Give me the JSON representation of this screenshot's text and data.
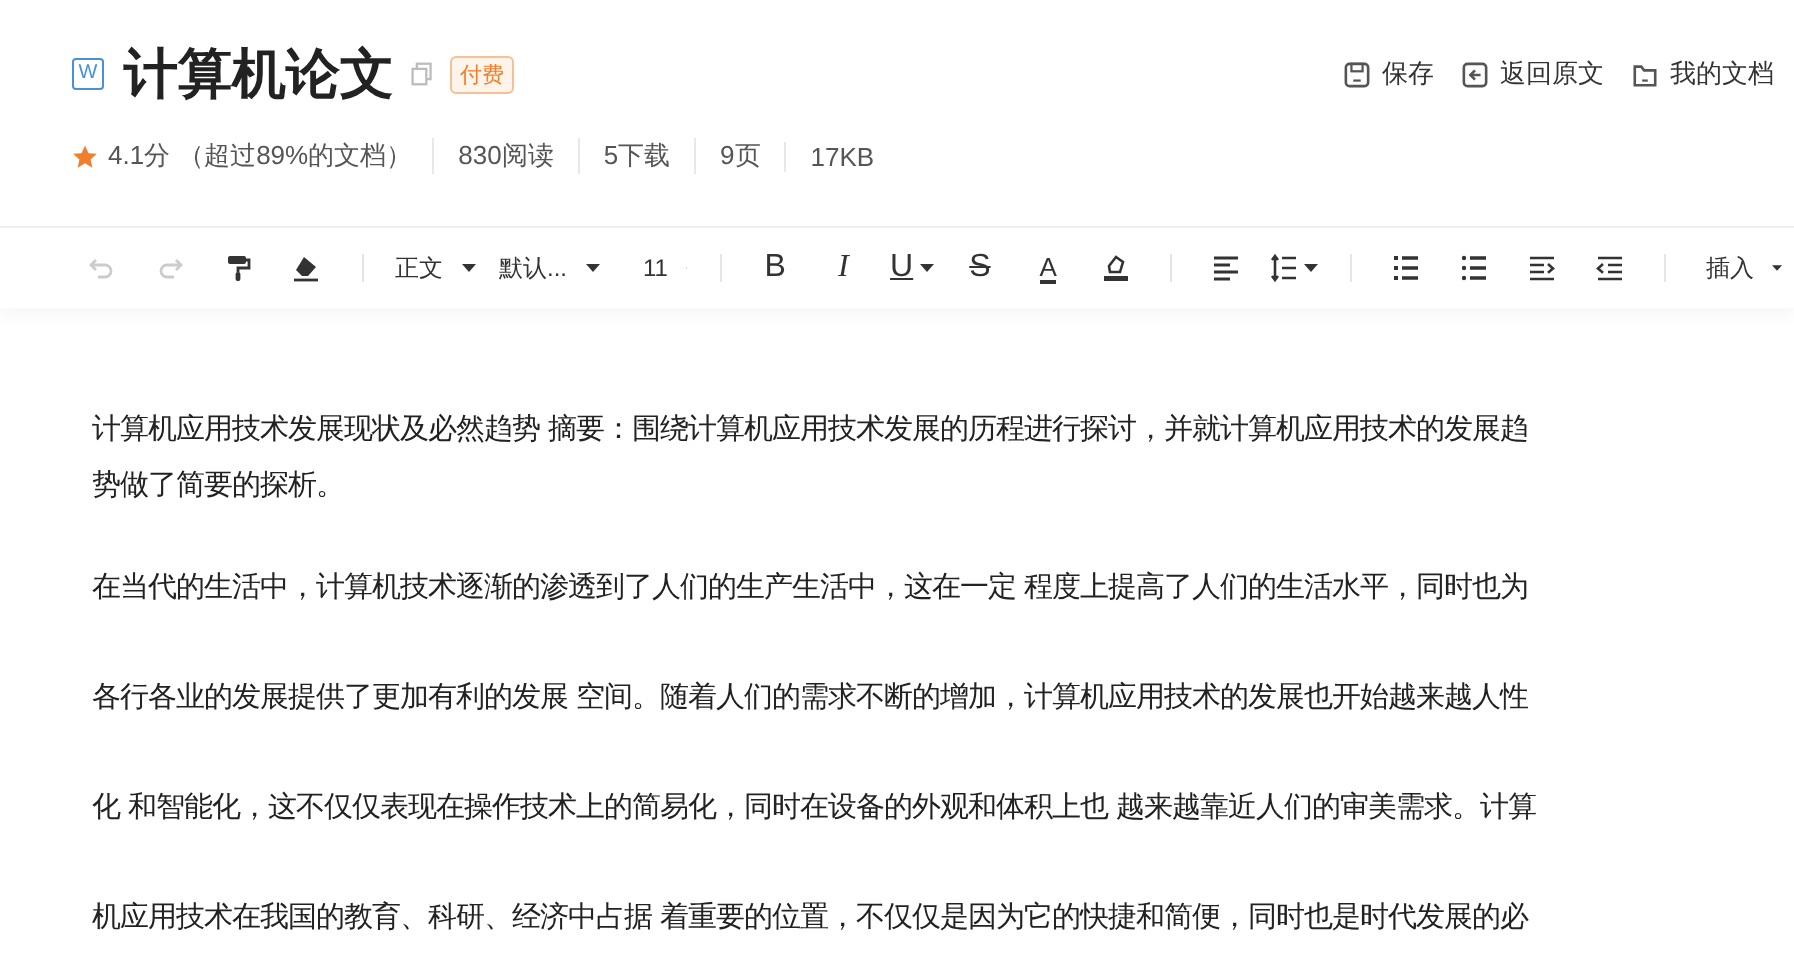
{
  "header": {
    "file_type": "W",
    "title": "计算机论文",
    "badge": "付费",
    "actions": [
      {
        "kind": "save",
        "label": "保存"
      },
      {
        "kind": "back",
        "label": "返回原文"
      },
      {
        "kind": "docs",
        "label": "我的文档"
      }
    ]
  },
  "meta": {
    "score": "4.1分",
    "rank": "（超过89%的文档）",
    "stats": [
      "830阅读",
      "5下载",
      "9页",
      "17KB"
    ]
  },
  "toolbar": [
    {
      "kind": "undo",
      "disabled": true
    },
    {
      "kind": "redo",
      "disabled": true
    },
    {
      "kind": "painter",
      "disabled": false
    },
    {
      "kind": "eraser",
      "disabled": false
    },
    {
      "kind": "sep"
    },
    {
      "kind": "dropdown",
      "label": "正文"
    },
    {
      "kind": "dropdown",
      "label": "默认..."
    },
    {
      "kind": "dropdown",
      "label": "11"
    },
    {
      "kind": "sep"
    },
    {
      "kind": "bold",
      "label": "B"
    },
    {
      "kind": "italic",
      "label": "I"
    },
    {
      "kind": "underline",
      "label": "U"
    },
    {
      "kind": "strike",
      "label": "S"
    },
    {
      "kind": "fontcolor",
      "label": "A"
    },
    {
      "kind": "highlight"
    },
    {
      "kind": "sep"
    },
    {
      "kind": "align"
    },
    {
      "kind": "linespacing"
    },
    {
      "kind": "sep"
    },
    {
      "kind": "olist"
    },
    {
      "kind": "ulist"
    },
    {
      "kind": "indent"
    },
    {
      "kind": "outdent"
    },
    {
      "kind": "sep"
    },
    {
      "kind": "dropdown",
      "label": "插入"
    }
  ],
  "document": {
    "paragraphs": [
      {
        "lines": [
          "计算机应用技术发展现状及必然趋势 摘要：围绕计算机应用技术发展的历程进行探讨，并就计算机应用技术的发展趋",
          "势做了简要的探析。"
        ]
      },
      {
        "lines": [
          "在当代的生活中，计算机技术逐渐的渗透到了人们的生产生活中，这在一定 程度上提高了人们的生活水平，同时也为",
          "各行各业的发展提供了更加有利的发展 空间。随着人们的需求不断的增加，计算机应用技术的发展也开始越来越人性",
          "化 和智能化，这不仅仅表现在操作技术上的简易化，同时在设备的外观和体积上也 越来越靠近人们的审美需求。计算",
          "机应用技术在我国的教育、科研、经济中占据 着重要的位置，不仅仅是因为它的快捷和简便，同时也是时代发展的必"
        ]
      }
    ]
  }
}
